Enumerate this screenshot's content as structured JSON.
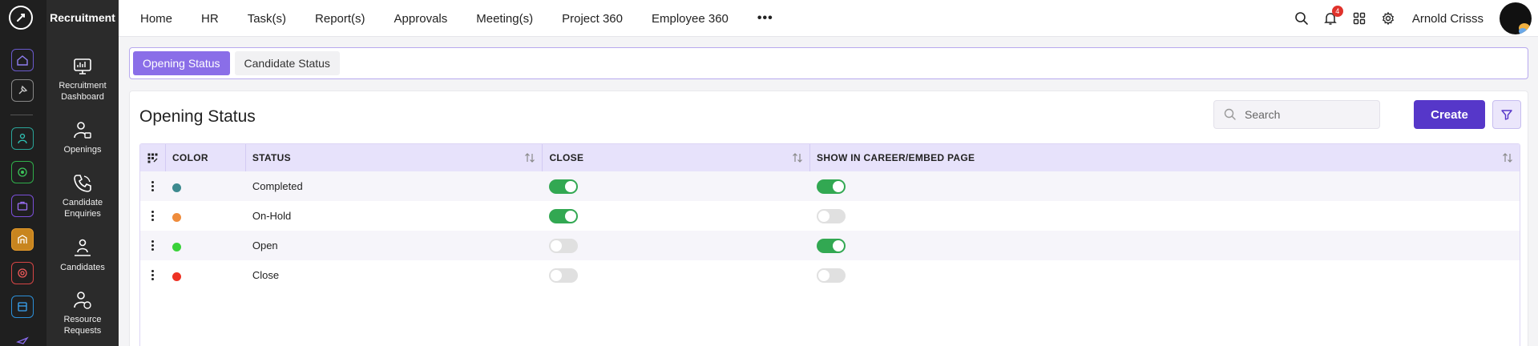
{
  "module": {
    "title": "Recruitment",
    "items": [
      {
        "label": "Recruitment Dashboard"
      },
      {
        "label": "Openings"
      },
      {
        "label": "Candidate Enquiries"
      },
      {
        "label": "Candidates"
      },
      {
        "label": "Resource Requests"
      }
    ]
  },
  "nav": {
    "items": [
      "Home",
      "HR",
      "Task(s)",
      "Report(s)",
      "Approvals",
      "Meeting(s)",
      "Project 360",
      "Employee 360"
    ],
    "more": "•••"
  },
  "header": {
    "notification_count": "4",
    "username": "Arnold Crisss"
  },
  "tabs": [
    {
      "label": "Opening Status",
      "active": true
    },
    {
      "label": "Candidate Status",
      "active": false
    }
  ],
  "page": {
    "title": "Opening Status",
    "search_placeholder": "Search",
    "create_label": "Create"
  },
  "table": {
    "columns": [
      "COLOR",
      "STATUS",
      "CLOSE",
      "SHOW IN CAREER/EMBED PAGE"
    ],
    "rows": [
      {
        "color": "#3d8a8f",
        "status": "Completed",
        "close": true,
        "show_in_career": true
      },
      {
        "color": "#ef8c3c",
        "status": "On-Hold",
        "close": true,
        "show_in_career": false
      },
      {
        "color": "#3ad23a",
        "status": "Open",
        "close": false,
        "show_in_career": true
      },
      {
        "color": "#ee3224",
        "status": "Close",
        "close": false,
        "show_in_career": false
      }
    ]
  },
  "colors": {
    "accent": "#5637c9",
    "tab_active": "#8a6ee8",
    "toggle_on": "#32a852"
  }
}
